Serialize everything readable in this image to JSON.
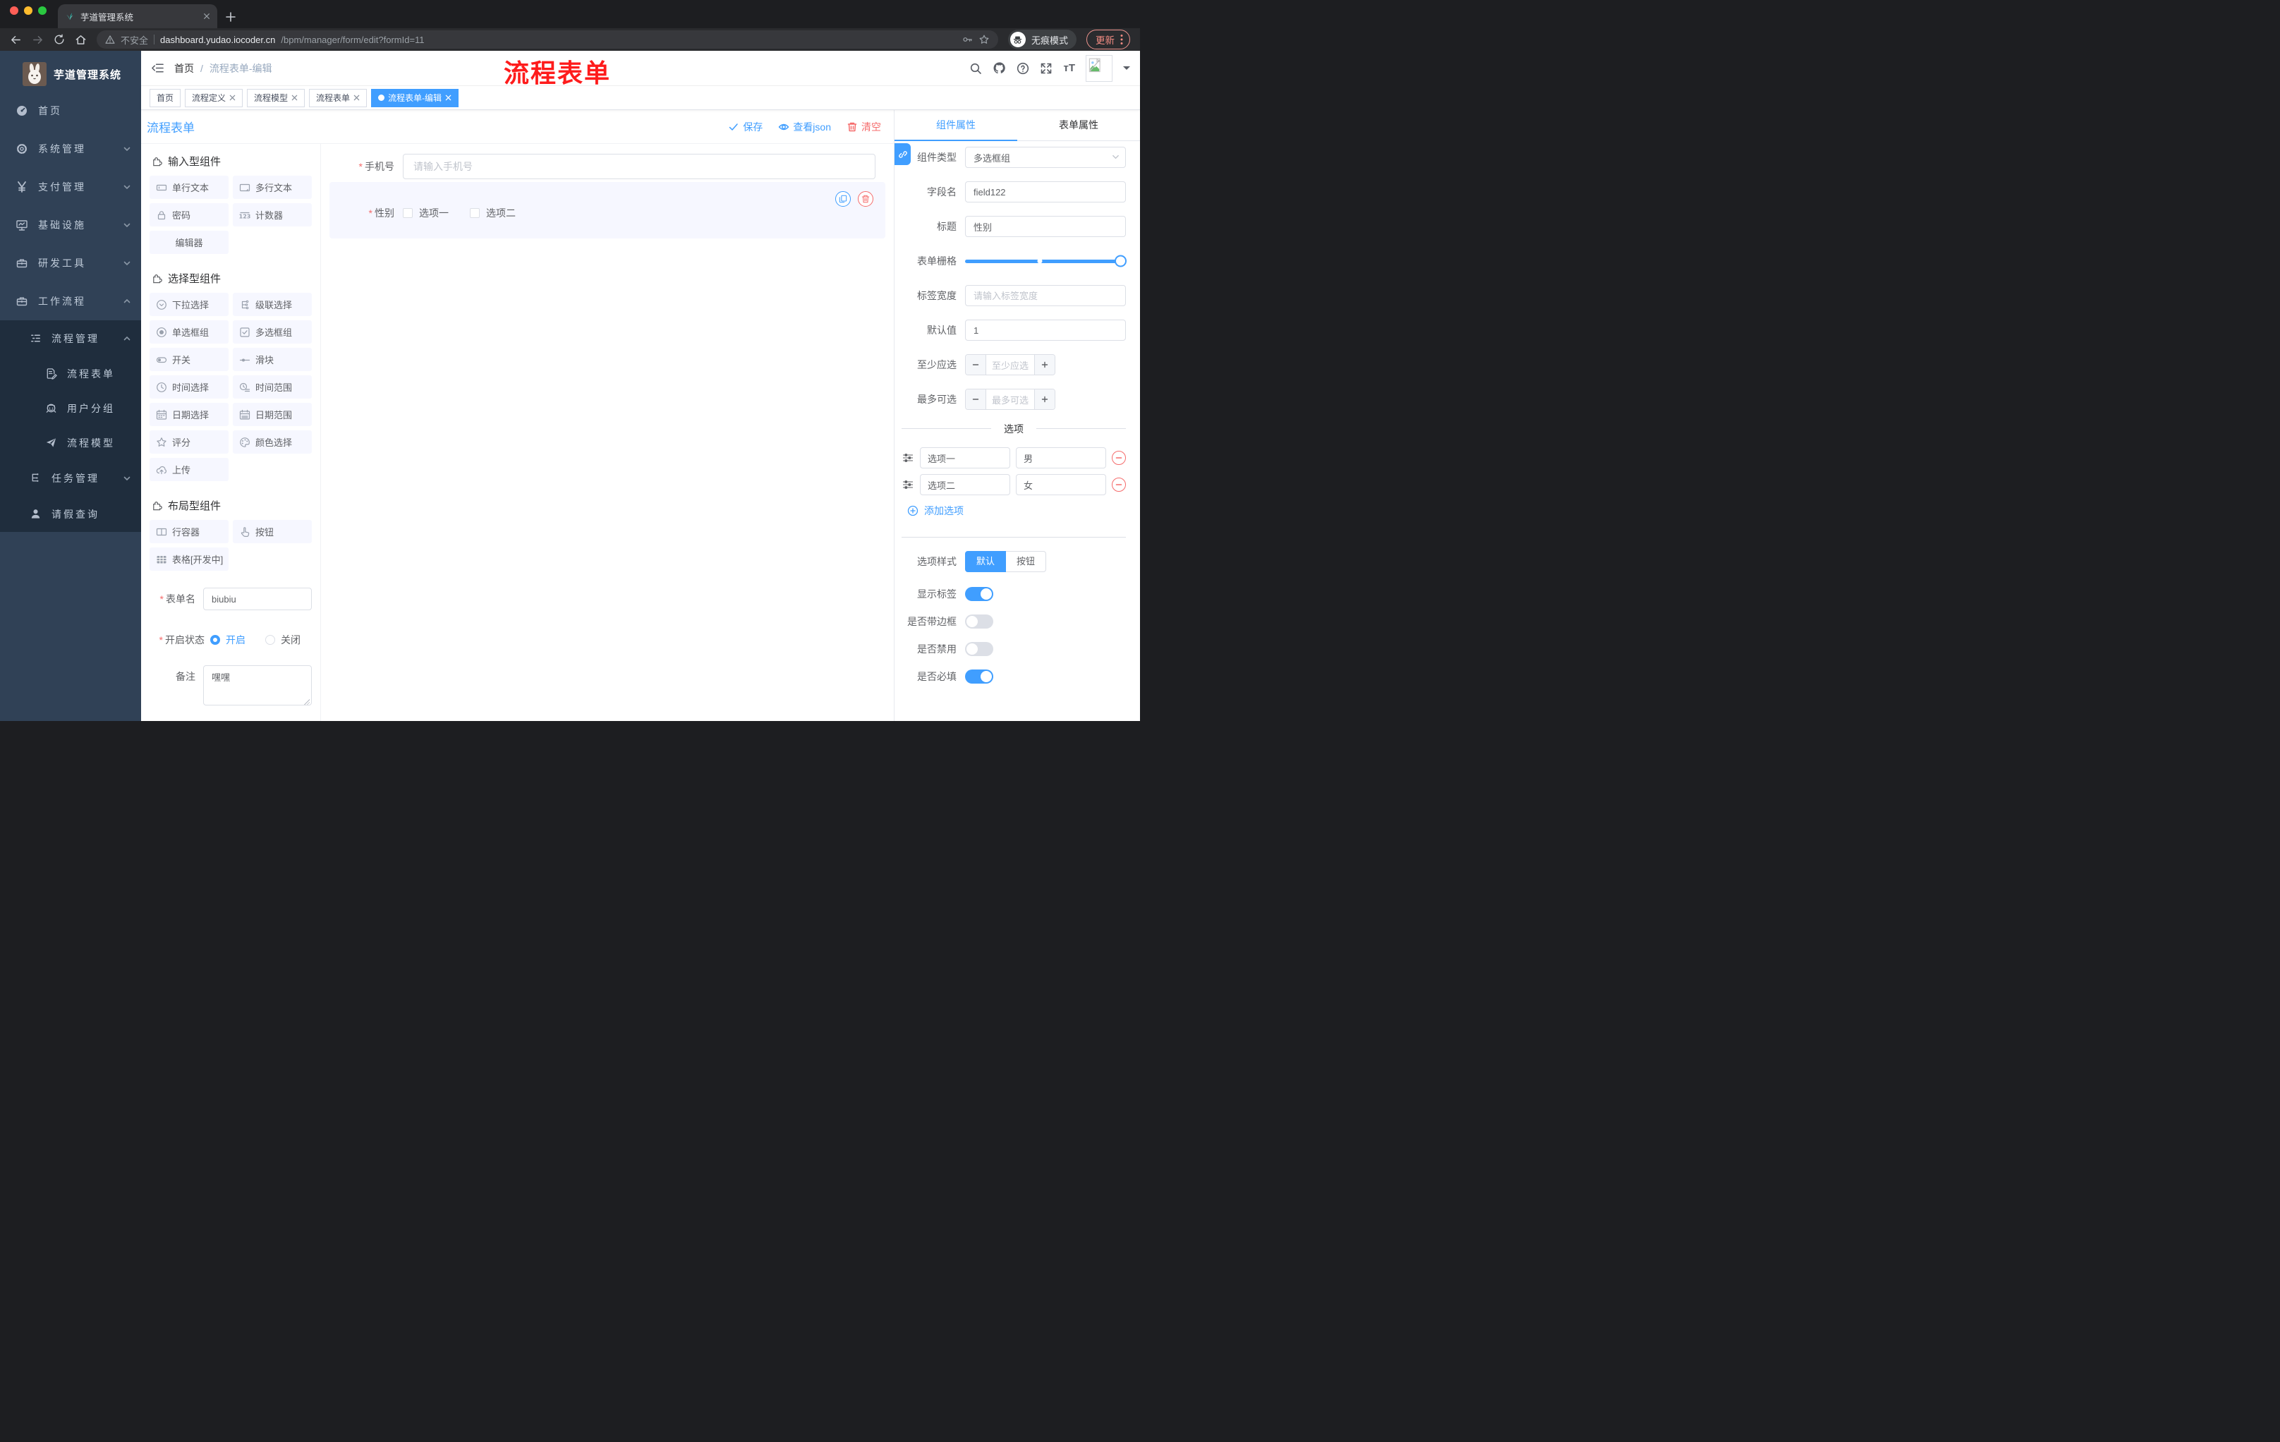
{
  "colors": {
    "primary": "#409eff",
    "danger": "#f56c6c",
    "sidebar_bg": "#304156",
    "submenu_bg": "#1f2d3d",
    "watermark_red": "#fe1c1c",
    "active_tag_bg": "#409eff"
  },
  "browser": {
    "tab_title": "芋道管理系统",
    "security_label": "不安全",
    "url_domain": "dashboard.yudao.iocoder.cn",
    "url_path": "/bpm/manager/form/edit?formId=11",
    "incognito_label": "无痕模式",
    "update_label": "更新"
  },
  "sidebar": {
    "logo_title": "芋道管理系统",
    "items": [
      {
        "label": "首页"
      },
      {
        "label": "系统管理"
      },
      {
        "label": "支付管理"
      },
      {
        "label": "基础设施"
      },
      {
        "label": "研发工具"
      },
      {
        "label": "工作流程"
      },
      {
        "label": "流程管理"
      },
      {
        "label": "流程表单"
      },
      {
        "label": "用户分组"
      },
      {
        "label": "流程模型"
      },
      {
        "label": "任务管理"
      },
      {
        "label": "请假查询"
      }
    ]
  },
  "header": {
    "breadcrumb_home": "首页",
    "breadcrumb_sep": "/",
    "breadcrumb_current": "流程表单-编辑",
    "watermark": "流程表单"
  },
  "tags": [
    {
      "label": "首页"
    },
    {
      "label": "流程定义"
    },
    {
      "label": "流程模型"
    },
    {
      "label": "流程表单"
    },
    {
      "label": "流程表单-编辑"
    }
  ],
  "designer": {
    "title": "流程表单",
    "save_label": "保存",
    "view_json_label": "查看json",
    "clear_label": "清空",
    "palette": {
      "sections": [
        {
          "title": "输入型组件",
          "items": [
            {
              "label": "单行文本"
            },
            {
              "label": "多行文本"
            },
            {
              "label": "密码"
            },
            {
              "label": "计数器"
            },
            {
              "label": "编辑器"
            }
          ]
        },
        {
          "title": "选择型组件",
          "items": [
            {
              "label": "下拉选择"
            },
            {
              "label": "级联选择"
            },
            {
              "label": "单选框组"
            },
            {
              "label": "多选框组"
            },
            {
              "label": "开关"
            },
            {
              "label": "滑块"
            },
            {
              "label": "时间选择"
            },
            {
              "label": "时间范围"
            },
            {
              "label": "日期选择"
            },
            {
              "label": "日期范围"
            },
            {
              "label": "评分"
            },
            {
              "label": "颜色选择"
            },
            {
              "label": "上传"
            }
          ]
        },
        {
          "title": "布局型组件",
          "items": [
            {
              "label": "行容器"
            },
            {
              "label": "按钮"
            },
            {
              "label": "表格[开发中]"
            }
          ]
        }
      ]
    },
    "meta": {
      "form_name_label": "表单名",
      "form_name_value": "biubiu",
      "status_label": "开启状态",
      "status_on": "开启",
      "status_off": "关闭",
      "remark_label": "备注",
      "remark_value": "嘿嘿"
    },
    "canvas": {
      "phone_label": "手机号",
      "phone_placeholder": "请输入手机号",
      "gender_label": "性别",
      "gender_option1": "选项一",
      "gender_option2": "选项二"
    }
  },
  "inspector": {
    "tab_component": "组件属性",
    "tab_form": "表单属性",
    "component_type_label": "组件类型",
    "component_type_value": "多选框组",
    "field_name_label": "字段名",
    "field_name_value": "field122",
    "title_label": "标题",
    "title_value": "性别",
    "grid_label": "表单栅格",
    "label_width_label": "标签宽度",
    "label_width_placeholder": "请输入标签宽度",
    "default_label": "默认值",
    "default_value": "1",
    "min_label": "至少应选",
    "min_placeholder": "至少应选",
    "max_label": "最多可选",
    "max_placeholder": "最多可选",
    "options_title": "选项",
    "options": [
      {
        "name": "选项一",
        "value": "男"
      },
      {
        "name": "选项二",
        "value": "女"
      }
    ],
    "add_option_label": "添加选项",
    "style_label": "选项样式",
    "style_default": "默认",
    "style_button": "按钮",
    "show_label_label": "显示标签",
    "border_label": "是否带边框",
    "disabled_label": "是否禁用",
    "required_label": "是否必填"
  }
}
